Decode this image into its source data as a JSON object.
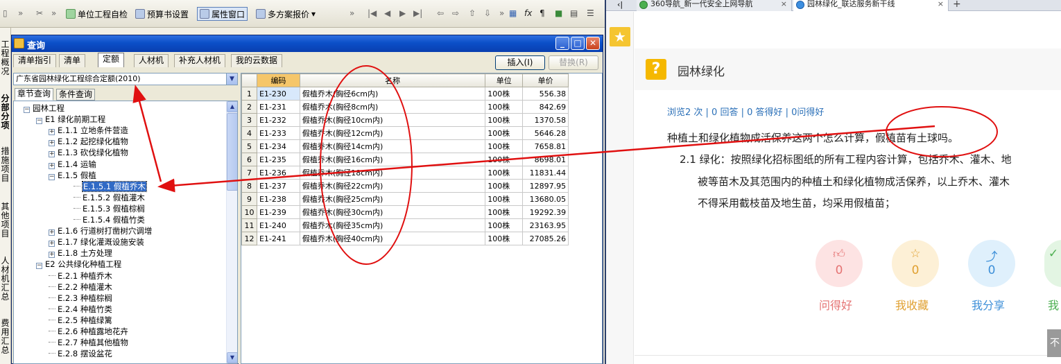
{
  "app": {
    "toolbar": {
      "unit_check": "单位工程自检",
      "budget_settings": "预算书设置",
      "attribute_window": "属性窗口",
      "multi_quote": "多方案报价"
    },
    "strip_texts": [
      "工程概况",
      "分部分项",
      "措施项目",
      "其他项目",
      "人材机汇总",
      "费用汇总"
    ]
  },
  "dialog": {
    "title": "查询",
    "tabs": [
      "清单指引",
      "清单",
      "定额",
      "人材机",
      "补充人材机",
      "我的云数据"
    ],
    "selected_tab": "定额",
    "insert_button": "插入(I)",
    "replace_button": "替换(R)",
    "library": "广东省园林绿化工程综合定额(2010)",
    "subtabs": [
      "章节查询",
      "条件查询"
    ],
    "tree": [
      {
        "label": "园林工程",
        "level": 0,
        "box": "−"
      },
      {
        "label": "E1 绿化前期工程",
        "level": 1,
        "box": "−"
      },
      {
        "label": "E.1.1 立地条件营造",
        "level": 2,
        "box": "+"
      },
      {
        "label": "E.1.2 起挖绿化植物",
        "level": 2,
        "box": "+"
      },
      {
        "label": "E.1.3 砍伐绿化植物",
        "level": 2,
        "box": "+"
      },
      {
        "label": "E.1.4 运输",
        "level": 2,
        "box": "+"
      },
      {
        "label": "E.1.5 假植",
        "level": 2,
        "box": "−"
      },
      {
        "label": "E.1.5.1 假植乔木",
        "level": 3,
        "box": "",
        "selected": true
      },
      {
        "label": "E.1.5.2 假植灌木",
        "level": 3,
        "box": ""
      },
      {
        "label": "E.1.5.3 假植棕榈",
        "level": 3,
        "box": ""
      },
      {
        "label": "E.1.5.4 假植竹类",
        "level": 3,
        "box": ""
      },
      {
        "label": "E.1.6 行道树打凿树穴调增",
        "level": 2,
        "box": "+"
      },
      {
        "label": "E.1.7 绿化灌溉设施安装",
        "level": 2,
        "box": "+"
      },
      {
        "label": "E.1.8 土方处理",
        "level": 2,
        "box": "+"
      },
      {
        "label": "E2 公共绿化种植工程",
        "level": 1,
        "box": "−"
      },
      {
        "label": "E.2.1 种植乔木",
        "level": 2,
        "box": ""
      },
      {
        "label": "E.2.2 种植灌木",
        "level": 2,
        "box": ""
      },
      {
        "label": "E.2.3 种植棕榈",
        "level": 2,
        "box": ""
      },
      {
        "label": "E.2.4 种植竹类",
        "level": 2,
        "box": ""
      },
      {
        "label": "E.2.5 种植绿篱",
        "level": 2,
        "box": ""
      },
      {
        "label": "E.2.6 种植露地花卉",
        "level": 2,
        "box": ""
      },
      {
        "label": "E.2.7 种植其他植物",
        "level": 2,
        "box": ""
      },
      {
        "label": "E.2.8 摆设盆花",
        "level": 2,
        "box": ""
      }
    ],
    "grid": {
      "headers": [
        "",
        "编码",
        "名称",
        "单位",
        "单价"
      ],
      "rows": [
        [
          "1",
          "E1-230",
          "假植乔木(胸径6cm内)",
          "100株",
          "556.38"
        ],
        [
          "2",
          "E1-231",
          "假植乔木(胸径8cm内)",
          "100株",
          "842.69"
        ],
        [
          "3",
          "E1-232",
          "假植乔木(胸径10cm内)",
          "100株",
          "1370.58"
        ],
        [
          "4",
          "E1-233",
          "假植乔木(胸径12cm内)",
          "100株",
          "5646.28"
        ],
        [
          "5",
          "E1-234",
          "假植乔木(胸径14cm内)",
          "100株",
          "7658.81"
        ],
        [
          "6",
          "E1-235",
          "假植乔木(胸径16cm内)",
          "100株",
          "8698.01"
        ],
        [
          "7",
          "E1-236",
          "假植乔木(胸径18cm内)",
          "100株",
          "11831.44"
        ],
        [
          "8",
          "E1-237",
          "假植乔木(胸径22cm内)",
          "100株",
          "12897.95"
        ],
        [
          "9",
          "E1-238",
          "假植乔木(胸径25cm内)",
          "100株",
          "13680.05"
        ],
        [
          "10",
          "E1-239",
          "假植乔木(胸径30cm内)",
          "100株",
          "19292.39"
        ],
        [
          "11",
          "E1-240",
          "假植乔木(胸径35cm内)",
          "100株",
          "23163.95"
        ],
        [
          "12",
          "E1-241",
          "假植乔木(胸径40cm内)",
          "100株",
          "27085.26"
        ]
      ]
    }
  },
  "browser": {
    "tabs": [
      {
        "title": "360导航_新一代安全上网导航"
      },
      {
        "title": "园林绿化_联达服务新干线"
      }
    ],
    "question": {
      "title": "园林绿化",
      "stats": "浏览2 次 | 0 回答 | 0 答得好 | 0问得好",
      "text": "种植土和绿化植物成活保养这两个怎么计算，假植苗有土球吗。",
      "answer_lines": [
        "2.1 绿化：按照绿化招标图纸的所有工程内容计算，包括乔木、灌木、地",
        "被等苗木及其范围内的种植土和绿化植物成活保养，以上乔木、灌木",
        "不得采用截枝苗及地生苗，均采用假植苗；"
      ]
    },
    "actions": [
      {
        "label": "问得好",
        "count": "0",
        "color": "#e57373",
        "bg": "#fde3e3"
      },
      {
        "label": "我收藏",
        "count": "0",
        "color": "#e0a030",
        "bg": "#fdf0d6"
      },
      {
        "label": "我分享",
        "count": "0",
        "color": "#3d8fd8",
        "bg": "#dff0fc"
      },
      {
        "label": "我",
        "count": "",
        "color": "#4caf50",
        "bg": "#e3f5e3"
      }
    ]
  }
}
